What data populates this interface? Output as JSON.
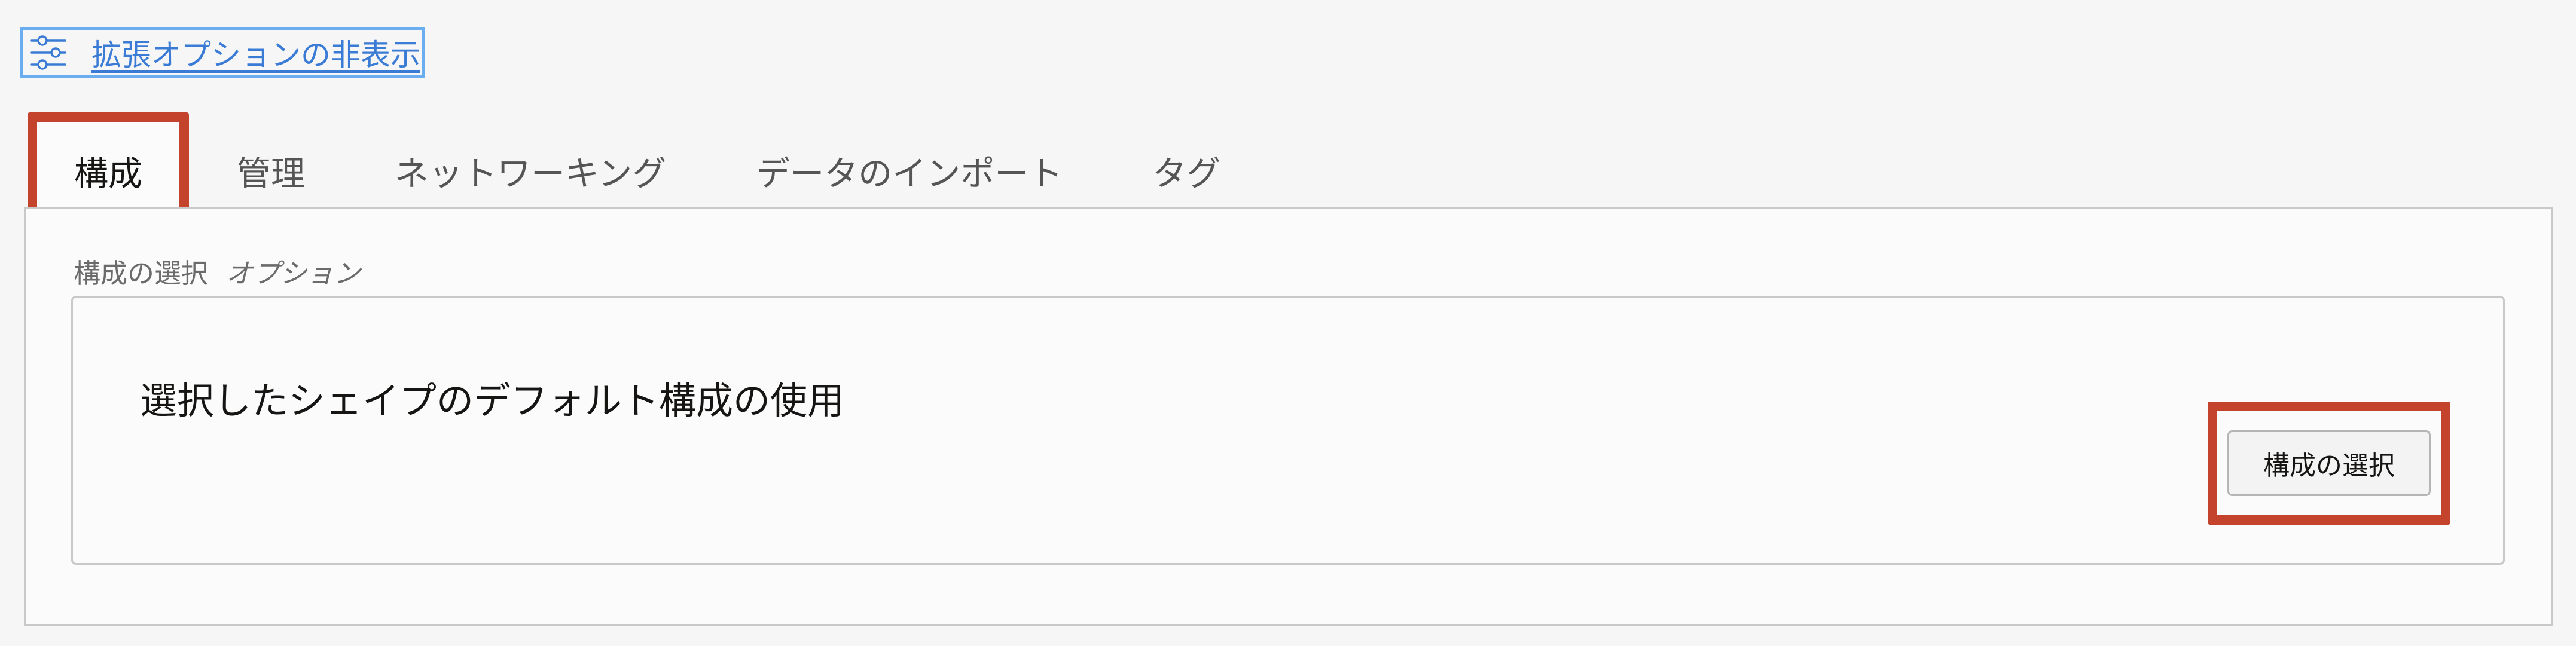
{
  "advanced_options": {
    "label": "拡張オプションの非表示",
    "icon": "sliders-icon"
  },
  "tabs": [
    {
      "label": "構成",
      "active": true
    },
    {
      "label": "管理",
      "active": false
    },
    {
      "label": "ネットワーキング",
      "active": false
    },
    {
      "label": "データのインポート",
      "active": false
    },
    {
      "label": "タグ",
      "active": false
    }
  ],
  "configuration": {
    "field_label": "構成の選択",
    "optional_label": "オプション",
    "current_value": "選択したシェイプのデフォルト構成の使用",
    "select_button_label": "構成の選択"
  },
  "colors": {
    "highlight": "#c3432d",
    "link": "#3a7bd5",
    "focus_border": "#6aaeef"
  }
}
